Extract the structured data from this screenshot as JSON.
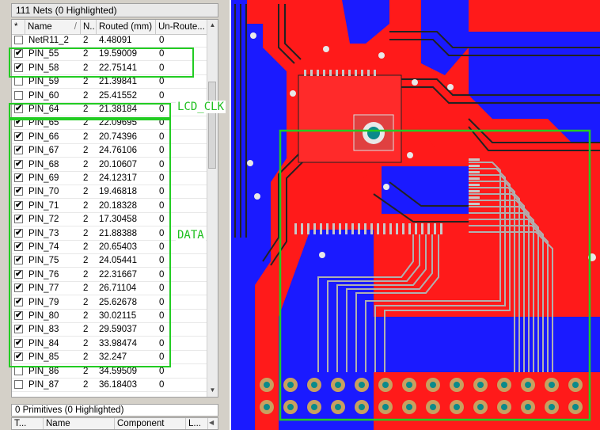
{
  "nets_panel": {
    "title": "111 Nets (0 Highlighted)",
    "columns": [
      "*",
      "Name",
      "N..",
      "Routed (mm)",
      "Un-Route..."
    ],
    "sort_mark": "/",
    "rows": [
      {
        "checked": false,
        "name": "NetR11_2",
        "nodes": "2",
        "routed": "4.48091",
        "unrouted": "0"
      },
      {
        "checked": true,
        "name": "PIN_55",
        "nodes": "2",
        "routed": "19.59009",
        "unrouted": "0"
      },
      {
        "checked": true,
        "name": "PIN_58",
        "nodes": "2",
        "routed": "22.75141",
        "unrouted": "0"
      },
      {
        "checked": false,
        "name": "PIN_59",
        "nodes": "2",
        "routed": "21.39841",
        "unrouted": "0"
      },
      {
        "checked": false,
        "name": "PIN_60",
        "nodes": "2",
        "routed": "25.41552",
        "unrouted": "0"
      },
      {
        "checked": true,
        "name": "PIN_64",
        "nodes": "2",
        "routed": "21.38184",
        "unrouted": "0"
      },
      {
        "checked": true,
        "name": "PIN_65",
        "nodes": "2",
        "routed": "22.09695",
        "unrouted": "0"
      },
      {
        "checked": true,
        "name": "PIN_66",
        "nodes": "2",
        "routed": "20.74396",
        "unrouted": "0"
      },
      {
        "checked": true,
        "name": "PIN_67",
        "nodes": "2",
        "routed": "24.76106",
        "unrouted": "0"
      },
      {
        "checked": true,
        "name": "PIN_68",
        "nodes": "2",
        "routed": "20.10607",
        "unrouted": "0"
      },
      {
        "checked": true,
        "name": "PIN_69",
        "nodes": "2",
        "routed": "24.12317",
        "unrouted": "0"
      },
      {
        "checked": true,
        "name": "PIN_70",
        "nodes": "2",
        "routed": "19.46818",
        "unrouted": "0"
      },
      {
        "checked": true,
        "name": "PIN_71",
        "nodes": "2",
        "routed": "20.18328",
        "unrouted": "0"
      },
      {
        "checked": true,
        "name": "PIN_72",
        "nodes": "2",
        "routed": "17.30458",
        "unrouted": "0"
      },
      {
        "checked": true,
        "name": "PIN_73",
        "nodes": "2",
        "routed": "21.88388",
        "unrouted": "0"
      },
      {
        "checked": true,
        "name": "PIN_74",
        "nodes": "2",
        "routed": "20.65403",
        "unrouted": "0"
      },
      {
        "checked": true,
        "name": "PIN_75",
        "nodes": "2",
        "routed": "24.05441",
        "unrouted": "0"
      },
      {
        "checked": true,
        "name": "PIN_76",
        "nodes": "2",
        "routed": "22.31667",
        "unrouted": "0"
      },
      {
        "checked": true,
        "name": "PIN_77",
        "nodes": "2",
        "routed": "26.71104",
        "unrouted": "0"
      },
      {
        "checked": true,
        "name": "PIN_79",
        "nodes": "2",
        "routed": "25.62678",
        "unrouted": "0"
      },
      {
        "checked": true,
        "name": "PIN_80",
        "nodes": "2",
        "routed": "30.02115",
        "unrouted": "0"
      },
      {
        "checked": true,
        "name": "PIN_83",
        "nodes": "2",
        "routed": "29.59037",
        "unrouted": "0"
      },
      {
        "checked": true,
        "name": "PIN_84",
        "nodes": "2",
        "routed": "33.98474",
        "unrouted": "0"
      },
      {
        "checked": true,
        "name": "PIN_85",
        "nodes": "2",
        "routed": "32.247",
        "unrouted": "0"
      },
      {
        "checked": false,
        "name": "PIN_86",
        "nodes": "2",
        "routed": "34.59509",
        "unrouted": "0"
      },
      {
        "checked": false,
        "name": "PIN_87",
        "nodes": "2",
        "routed": "36.18403",
        "unrouted": "0"
      }
    ]
  },
  "annotations": {
    "lcd_clk": "LCD_CLK",
    "data": "DATA"
  },
  "primitives_panel": {
    "title": "0 Primitives (0 Highlighted)",
    "columns": [
      "T...",
      "Name",
      "Component",
      "L..."
    ]
  },
  "icons": {
    "scroll_up": "▲",
    "scroll_down": "▼",
    "scroll_left": "◀",
    "check": "✔"
  },
  "colors": {
    "copper_top": "#ff1a1a",
    "copper_bottom": "#1a1aff",
    "trace_selected": "#b0b0b0",
    "highlight": "#22cc22",
    "pad": "#c8a060",
    "via": "#0a8a8a"
  }
}
